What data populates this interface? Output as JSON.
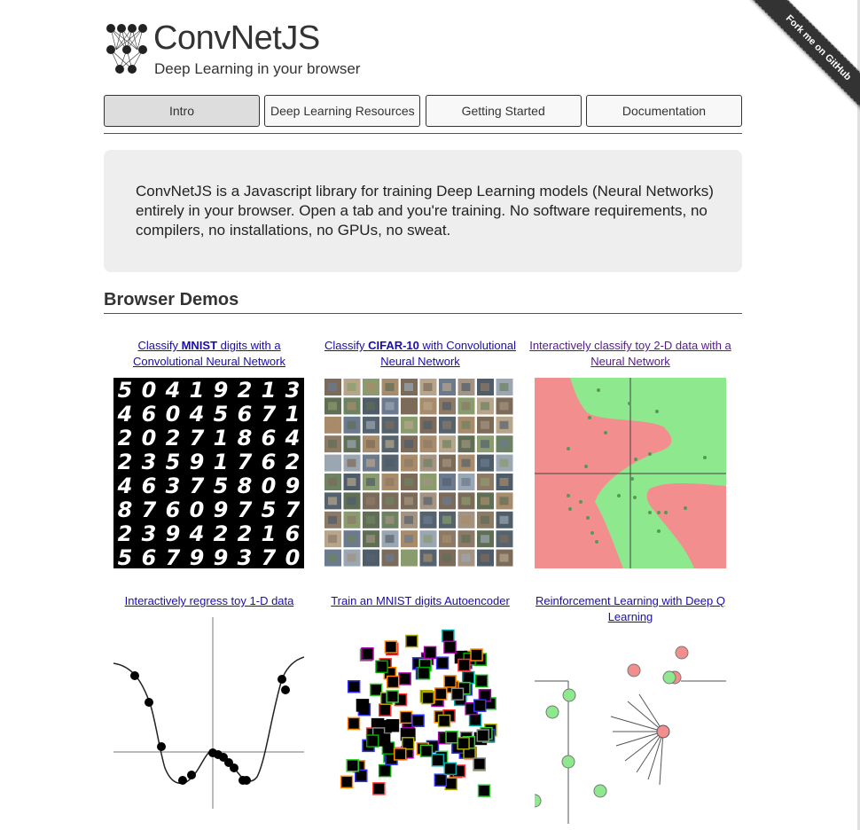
{
  "brand": {
    "name": "ConvNetJS",
    "tagline": "Deep Learning in your browser"
  },
  "ribbon": {
    "label": "Fork me on GitHub"
  },
  "nav": {
    "items": [
      {
        "label": "Intro",
        "active": true
      },
      {
        "label": "Deep Learning Resources",
        "active": false
      },
      {
        "label": "Getting Started",
        "active": false
      },
      {
        "label": "Documentation",
        "active": false
      }
    ]
  },
  "intro": {
    "text": "ConvNetJS is a Javascript library for training Deep Learning models (Neural Networks) entirely in your browser. Open a tab and you're training. No software requirements, no compilers, no installations, no GPUs, no sweat."
  },
  "demos_section": {
    "title": "Browser Demos",
    "demos": [
      {
        "pre": "Classify ",
        "bold": "MNIST",
        "post": " digits with a Convolutional Neural Network",
        "visited": false,
        "thumb": "mnist-digits-grid"
      },
      {
        "pre": "Classify ",
        "bold": "CIFAR-10",
        "post": " with Convolutional Neural Network",
        "visited": false,
        "thumb": "cifar10-image-grid"
      },
      {
        "pre": "Interactively classify toy 2-D data with a Neural Network",
        "bold": "",
        "post": "",
        "visited": true,
        "thumb": "classification-2d-plot"
      },
      {
        "pre": "Interactively regress toy 1-D data",
        "bold": "",
        "post": "",
        "visited": false,
        "thumb": "regression-1d-plot"
      },
      {
        "pre": "Train an MNIST digits Autoencoder",
        "bold": "",
        "post": "",
        "visited": false,
        "thumb": "autoencoder-embedding-plot"
      },
      {
        "pre": "Reinforcement Learning with Deep Q Learning",
        "bold": "",
        "post": "",
        "visited": false,
        "thumb": "rldemo-agent-world"
      }
    ]
  },
  "mnist_rows": [
    "50419213",
    "46045671",
    "20271864",
    "23591762",
    "46375809",
    "87609757",
    "23942216",
    "56799370"
  ],
  "colors": {
    "link": "#1a0dab",
    "visited_link": "#551a8b",
    "intro_bg": "#eeeeee",
    "class_red": "#f28e8e",
    "class_green": "#8ee88e"
  }
}
